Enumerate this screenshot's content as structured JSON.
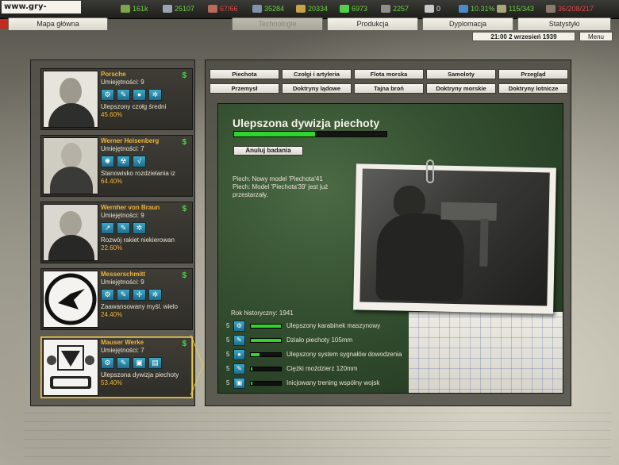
{
  "site_logo": "www.gry-online.pl",
  "resources": [
    {
      "icon": "manpower-icon",
      "value": "161k",
      "color": "green"
    },
    {
      "icon": "industry-icon",
      "value": "25107",
      "color": "green"
    },
    {
      "icon": "energy-icon",
      "value": "67/66",
      "color": "red"
    },
    {
      "icon": "metal-icon",
      "value": "35284",
      "color": "green"
    },
    {
      "icon": "rare-materials-icon",
      "value": "20334",
      "color": "green"
    },
    {
      "icon": "money-icon",
      "value": "6973",
      "color": "green"
    },
    {
      "icon": "oil-icon",
      "value": "2257",
      "color": "green"
    },
    {
      "icon": "transport-icon",
      "value": "0",
      "color": "white"
    },
    {
      "icon": "escort-icon",
      "value": "10.31%",
      "color": "green"
    },
    {
      "icon": "supplies-icon",
      "value": "115/343",
      "color": "green"
    },
    {
      "icon": "reserves-icon",
      "value": "36/208/217",
      "color": "red"
    }
  ],
  "tabs": [
    {
      "label": "Mapa główna",
      "active": false
    },
    {
      "label": "Technologie",
      "active": true
    },
    {
      "label": "Produkcja",
      "active": false
    },
    {
      "label": "Dyplomacja",
      "active": false
    },
    {
      "label": "Statystyki",
      "active": false
    }
  ],
  "date": "21:00 2 wrzesień 1939",
  "menu_label": "Menu",
  "scientists": [
    {
      "name": "Porsche",
      "skill": "Umiejętności: 9",
      "project": "Ulepszony czołg średni",
      "percent": "45.60%",
      "icons": [
        "gear-icon",
        "wrench-icon",
        "bulb-icon",
        "gears-icon"
      ],
      "selected": false
    },
    {
      "name": "Werner Heisenberg",
      "skill": "Umiejętności: 7",
      "project": "Stanowisko rozdzielania iz",
      "percent": "64.40%",
      "icons": [
        "atom-icon",
        "radiation-icon",
        "math-icon"
      ],
      "selected": false
    },
    {
      "name": "Wernher von Braun",
      "skill": "Umiejętności: 9",
      "project": "Rozwój rakiet niekierowan",
      "percent": "22.60%",
      "icons": [
        "rocket-icon",
        "wrench-icon",
        "gears-icon"
      ],
      "selected": false
    },
    {
      "name": "Messerschmitt",
      "skill": "Umiejętności: 9",
      "project": "Zaawansowany myśl. wielo",
      "percent": "24.40%",
      "icons": [
        "gear-icon",
        "wrench-icon",
        "propeller-icon",
        "gears-icon"
      ],
      "selected": false
    },
    {
      "name": "Mauser Werke",
      "skill": "Umiejętności: 7",
      "project": "Ulepszona dywizja piechoty",
      "percent": "53.40%",
      "icons": [
        "gear-icon",
        "wrench-icon",
        "book-icon",
        "document-icon"
      ],
      "selected": true
    }
  ],
  "categories_row1": [
    "Piechota",
    "Czołgi i artyleria",
    "Flota morska",
    "Samoloty",
    "Przegląd"
  ],
  "categories_row2": [
    "Przemysł",
    "Doktryny lądowe",
    "Tajna broń",
    "Doktryny morskie",
    "Doktryny lotnicze"
  ],
  "current": {
    "title": "Ulepszona dywizja piechoty",
    "progress": 0.53,
    "cancel_label": "Anuluj badania",
    "effects": [
      "Piech: Nowy model 'Piechota'41",
      "Piech: Model 'Piechota'39' jest już przestarzały."
    ],
    "historical_year": "Rok historyczny: 1941"
  },
  "queue": [
    {
      "num": "5",
      "icon": "gear-icon",
      "progress": 1.0,
      "label": "Ulepszony karabinek maszynowy"
    },
    {
      "num": "5",
      "icon": "wrench-icon",
      "progress": 1.0,
      "label": "Działo piechoty 105mm"
    },
    {
      "num": "5",
      "icon": "bulb-icon",
      "progress": 0.3,
      "label": "Ulepszony system sygnałów dowodzenia"
    },
    {
      "num": "5",
      "icon": "wrench-icon",
      "progress": 0.05,
      "label": "Ciężki moździerz 120mm"
    },
    {
      "num": "5",
      "icon": "book-icon",
      "progress": 0.05,
      "label": "Inicjowany trening wspólny wojsk"
    }
  ]
}
